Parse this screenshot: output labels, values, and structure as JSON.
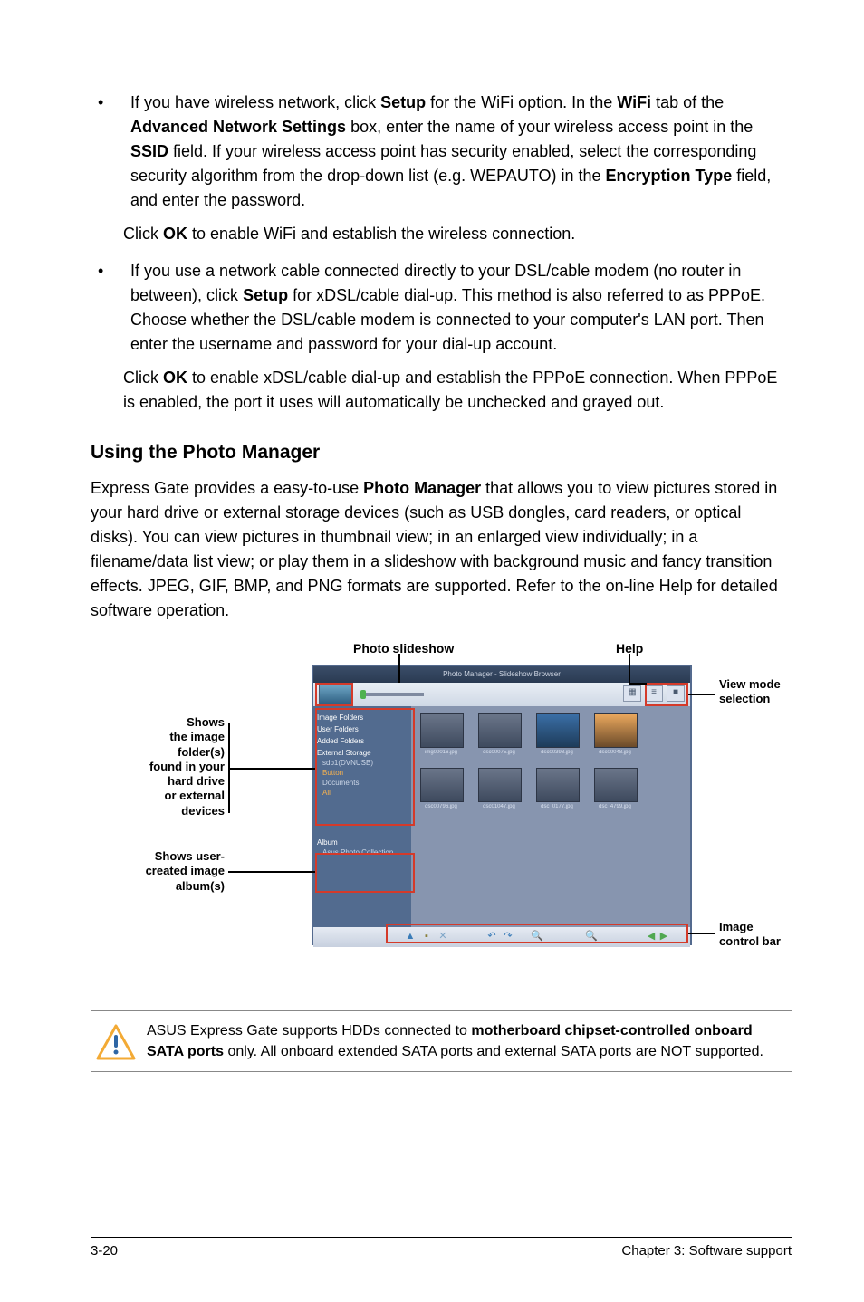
{
  "bullet1": {
    "text_pre": "If you have wireless network, click ",
    "bold_setup": "Setup",
    "text_mid1": " for the WiFi option. In the ",
    "bold_wifi": "WiFi",
    "text_mid2": " tab of the ",
    "bold_ans": "Advanced Network Settings",
    "text_mid3": " box, enter the name of your wireless access point in the ",
    "bold_ssid": "SSID",
    "text_mid4": " field. If your wireless access point has security enabled, select the corresponding security algorithm from the drop-down list (e.g. WEPAUTO) in the ",
    "bold_enc": "Encryption Type",
    "text_end": " field, and enter the password."
  },
  "bullet1_after_pre": "Click ",
  "bullet1_after_bold": "OK",
  "bullet1_after_end": " to enable WiFi and establish the wireless connection.",
  "bullet2": {
    "text_pre": "If you use a network cable connected directly to your DSL/cable modem (no router in between), click ",
    "bold_setup": "Setup",
    "text_end": " for xDSL/cable dial-up. This method is also referred to as PPPoE. Choose whether the DSL/cable modem is connected to your computer's LAN port. Then enter the username and password for your dial-up account."
  },
  "bullet2_after_pre": "Click ",
  "bullet2_after_bold": "OK",
  "bullet2_after_end": " to enable xDSL/cable dial-up and establish the PPPoE connection. When PPPoE is enabled, the port it uses will automatically be unchecked and grayed out.",
  "section_heading": "Using the Photo Manager",
  "body_pre": "Express Gate  provides a easy-to-use ",
  "body_bold": "Photo Manager",
  "body_end": " that allows you to view pictures stored in your hard drive or external storage devices (such as USB dongles, card readers, or optical disks). You can view pictures in thumbnail view; in an enlarged view individually; in a filename/data list view; or play them in a slideshow with background music and fancy transition effects. JPEG, GIF, BMP, and PNG formats are supported. Refer to the on-line Help for detailed software operation.",
  "diagram": {
    "top_label_slideshow": "Photo slideshow",
    "top_label_help": "Help",
    "right_label_viewmode_l1": "View mode",
    "right_label_viewmode_l2": "selection",
    "right_label_ctrl_l1": "Image",
    "right_label_ctrl_l2": "control bar",
    "left_label_folders_l1": "Shows",
    "left_label_folders_l2": "the image",
    "left_label_folders_l3": "folder(s)",
    "left_label_folders_l4": "found in your",
    "left_label_folders_l5": "hard drive",
    "left_label_folders_l6": "or external",
    "left_label_folders_l7": "devices",
    "left_label_albums_l1": "Shows user-",
    "left_label_albums_l2": "created image",
    "left_label_albums_l3": "album(s)",
    "titlebar_text": "Photo Manager - Slideshow Browser",
    "side_head_image_folders": "Image Folders",
    "side_head_user_folders": "User Folders",
    "side_head_added_folders": "Added Folders",
    "side_head_external": "External Storage",
    "side_item_sdb": "sdb1(DVNUSB)",
    "side_item_button": "Button",
    "side_item_documents": "Documents",
    "side_item_all": "All",
    "side_album": "Album",
    "side_album_collection": "Asus Photo Collection",
    "thumbs": [
      "img00016.jpg",
      "dsc00075.jpg",
      "dsc00398.jpg",
      "dsc00048.jpg",
      "dsc00796.jpg",
      "dsc01047.jpg",
      "dsc_0177.jpg",
      "dsc_4799.jpg"
    ]
  },
  "note_pre": "ASUS Express Gate supports HDDs connected to ",
  "note_bold": "motherboard chipset-controlled onboard SATA ports",
  "note_end": " only. All onboard extended SATA ports and external SATA ports are NOT supported.",
  "footer_left": "3-20",
  "footer_right": "Chapter 3: Software support"
}
